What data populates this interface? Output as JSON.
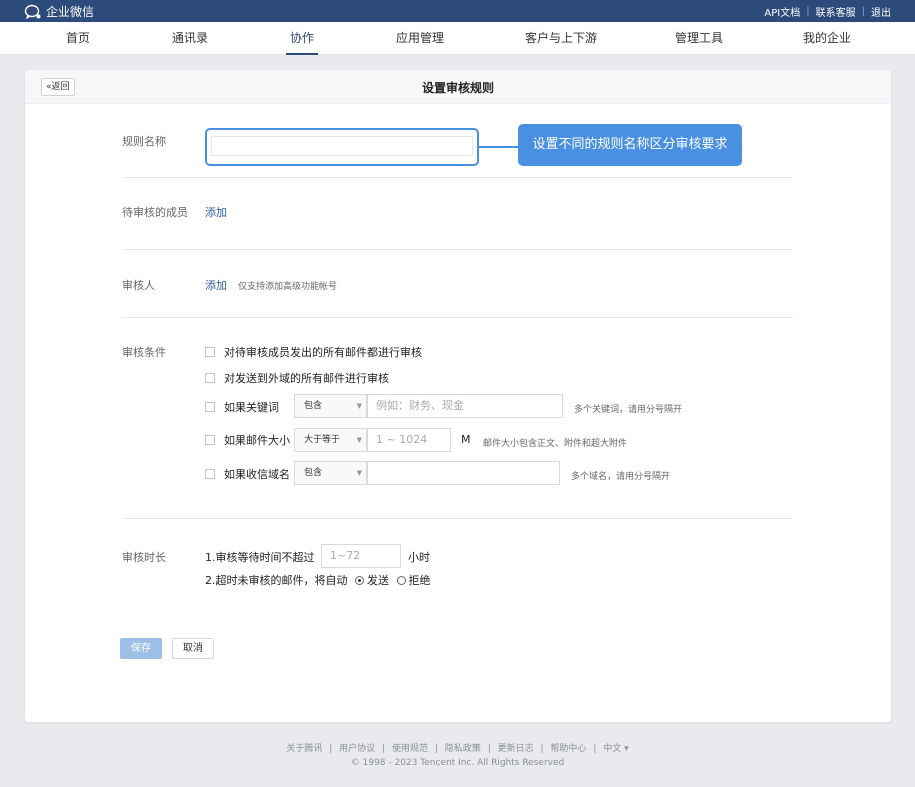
{
  "topbar": {
    "app_name": "企业微信",
    "links": [
      "API文档",
      "联系客服",
      "退出"
    ],
    "separator": "|"
  },
  "nav": {
    "items": [
      "首页",
      "通讯录",
      "协作",
      "应用管理",
      "客户与上下游",
      "管理工具",
      "我的企业"
    ],
    "active_index": 2
  },
  "header": {
    "back_label": "«返回",
    "title": "设置审核规则"
  },
  "form": {
    "rule_name": {
      "label": "规则名称",
      "value": "",
      "callout": "设置不同的规则名称区分审核要求"
    },
    "members": {
      "label": "待审核的成员",
      "add_label": "添加"
    },
    "reviewers": {
      "label": "审核人",
      "add_label": "添加",
      "hint": "仅支持添加高级功能帐号"
    },
    "conditions": {
      "label": "审核条件",
      "all_outgoing": "对待审核成员发出的所有邮件都进行审核",
      "external_domain": "对发送到外域的所有邮件进行审核",
      "keyword": {
        "label": "如果关键词",
        "operator": "包含",
        "placeholder": "例如：财务、现金",
        "hint": "多个关键词，请用分号隔开"
      },
      "size": {
        "label": "如果邮件大小",
        "operator": "大于等于",
        "placeholder": "1 ~ 1024",
        "unit": "M",
        "hint": "邮件大小包含正文、附件和超大附件"
      },
      "domain": {
        "label": "如果收信域名",
        "operator": "包含",
        "placeholder": "",
        "hint": "多个域名，请用分号隔开"
      }
    },
    "duration": {
      "label": "审核时长",
      "line1_prefix": "1.审核等待时间不超过",
      "hours_placeholder": "1~72",
      "hours_unit": "小时",
      "line2_prefix": "2.超时未审核的邮件，将自动",
      "option_send": "发送",
      "option_reject": "拒绝",
      "selected": "发送"
    }
  },
  "actions": {
    "save": "保存",
    "cancel": "取消"
  },
  "footer": {
    "links": [
      "关于腾讯",
      "用户协议",
      "使用规范",
      "隐私政策",
      "更新日志",
      "帮助中心",
      "中文 ▾"
    ],
    "separator": "|",
    "copyright": "© 1998 - 2023 Tencent Inc. All Rights Reserved"
  },
  "colors": {
    "brand": "#2c4a7a",
    "accent": "#4a90e2",
    "link": "#2c5aa0"
  }
}
